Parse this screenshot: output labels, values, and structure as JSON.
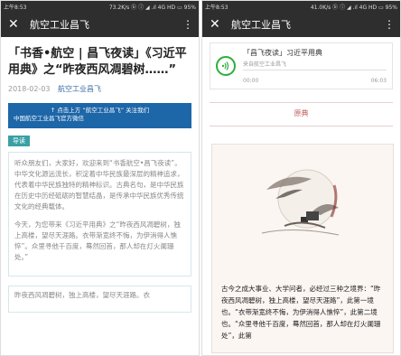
{
  "left": {
    "status": {
      "time": "上午8:53",
      "right": "73.2K/s ⓑ ⓘ ◢ .ıl 4G HD ▭ 95%"
    },
    "appbar": {
      "close": "✕",
      "title": "航空工业昌飞",
      "more": "⋮"
    },
    "article": {
      "title": "「书香•航空 | 昌飞夜读」《习近平用典》之“昨夜西风凋碧树……”",
      "date": "2018-02-03",
      "author": "航空工业昌飞"
    },
    "banner": {
      "line1": "↑ 点击上方 “航空工业昌飞” 关注我们",
      "line2": "中国航空工业昌飞官方微信"
    },
    "tag": "导读",
    "intro_p1": "听众朋友们，大家好，欢迎来到“书香航空•昌飞夜读”。中华文化源远流长，积淀着中华民族最深层的精神追求，代表着中华民族独特的精神标识。古典名句，是中华民族在历史中历经砥砺的智慧结晶，是传承中华民族优秀传统文化的经典载体。",
    "intro_p2": "今天，为您带来《习近平用典》之“昨夜西风凋碧树，独上高楼，望尽天涯路。衣带渐宽终不悔，为伊消得人憔悴”。众里寻他千百度，蓦然回首，那人却在灯火阑珊处。”",
    "next_box": "昨夜西风凋碧树，独上高楼，望尽天涯路。衣"
  },
  "right": {
    "status": {
      "time": "上午8:53",
      "right": "41.0K/s ⓑ ⓘ ◢ .ıl 4G HD ▭ 95%"
    },
    "appbar": {
      "close": "✕",
      "title": "航空工业昌飞",
      "more": "⋮"
    },
    "audio": {
      "title": "「昌飞夜读」习近平用典",
      "source": "来自航空工业昌飞",
      "time_start": "00:00",
      "time_end": "06:03",
      "play_icon": "play-circle-icon"
    },
    "section_label": "原典",
    "painting_text": "古今之成大事业、大学问者，必经过三种之境界：“昨夜西风凋碧树，独上高楼，望尽天涯路”，此第一境也。“衣带渐宽终不悔，为伊消得人憔悴”，此第二境也。“众里寻他千百度，蓦然回首，那人却在灯火阑珊处”，此第"
  }
}
